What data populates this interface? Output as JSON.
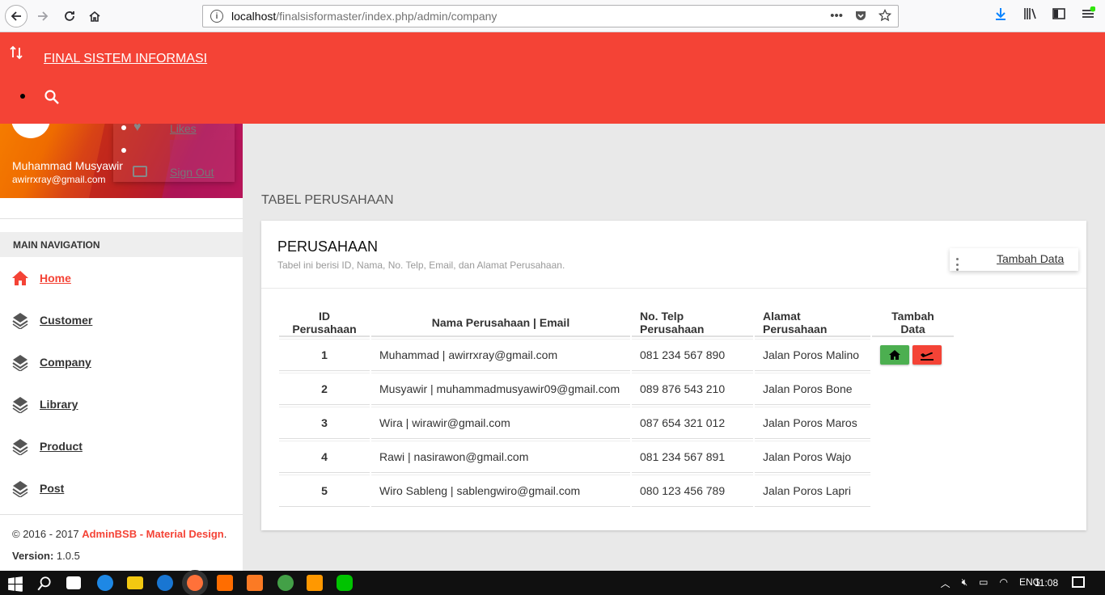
{
  "browser": {
    "url_host": "localhost",
    "url_path": "/finalsisformaster/index.php/admin/company"
  },
  "app_bar": {
    "title": "FINAL SISTEM INFORMASI"
  },
  "user": {
    "name": "Muhammad Musyawir",
    "email": "awirrxray@gmail.com",
    "menu_likes": "Likes",
    "menu_signout": "Sign Out"
  },
  "sidebar": {
    "header": "MAIN NAVIGATION",
    "items": [
      {
        "label": "Home",
        "icon": "home-icon"
      },
      {
        "label": "Customer",
        "icon": "layers-icon"
      },
      {
        "label": "Company",
        "icon": "layers-icon"
      },
      {
        "label": "Library",
        "icon": "layers-icon"
      },
      {
        "label": "Product",
        "icon": "layers-icon"
      },
      {
        "label": "Post",
        "icon": "layers-icon"
      }
    ],
    "footer_copy": "© 2016 - 2017 ",
    "footer_brand": "AdminBSB - Material Design",
    "footer_dot": ".",
    "version_label": "Version:",
    "version_value": " 1.0.5"
  },
  "main": {
    "section_title": "TABEL PERUSAHAAN",
    "card_title": "PERUSAHAAN",
    "card_subtitle": "Tabel ini berisi ID, Nama, No. Telp, Email, dan Alamat Perusahaan.",
    "header_menu_label": "Tambah Data",
    "table": {
      "headers": [
        "ID Perusahaan",
        "Nama Perusahaan | Email",
        "No. Telp Perusahaan",
        "Alamat Perusahaan",
        "Tambah Data"
      ],
      "rows": [
        {
          "id": "1",
          "name": "Muhammad | awirrxray@gmail.com",
          "phone": "081 234 567 890",
          "address": "Jalan Poros Malino"
        },
        {
          "id": "2",
          "name": "Musyawir | muhammadmusyawir09@gmail.com",
          "phone": "089 876 543 210",
          "address": "Jalan Poros Bone"
        },
        {
          "id": "3",
          "name": "Wira | wirawir@gmail.com",
          "phone": "087 654 321 012",
          "address": "Jalan Poros Maros"
        },
        {
          "id": "4",
          "name": "Rawi | nasirawon@gmail.com",
          "phone": "081 234 567 891",
          "address": "Jalan Poros Wajo"
        },
        {
          "id": "5",
          "name": "Wiro Sableng | sablengwiro@gmail.com",
          "phone": "080 123 456 789",
          "address": "Jalan Poros Lapri"
        }
      ]
    }
  },
  "taskbar": {
    "lang": "ENG",
    "time": "11:08"
  },
  "colors": {
    "accent": "#f44336",
    "success": "#4caf50"
  }
}
